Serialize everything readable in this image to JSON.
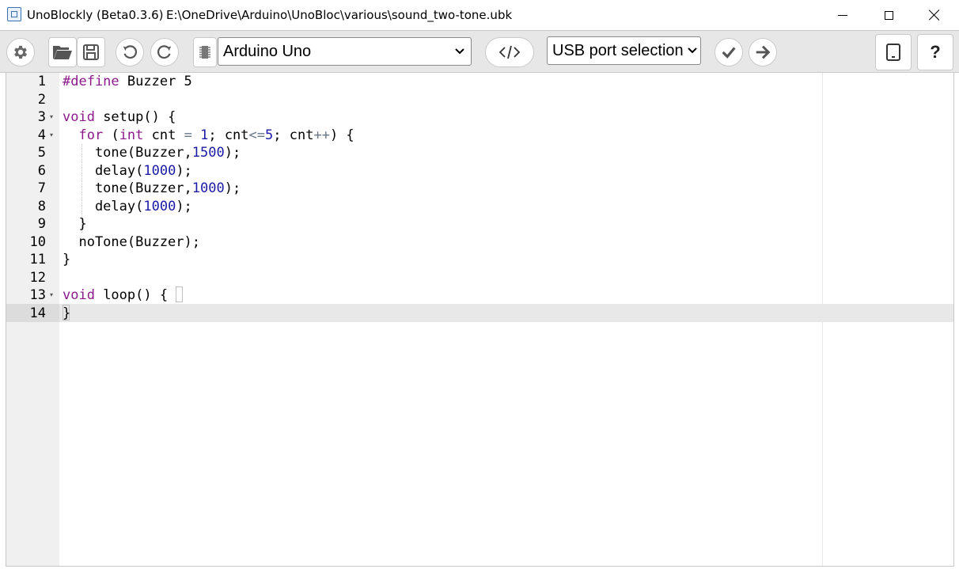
{
  "window": {
    "app_title": "UnoBlockly (Beta0.3.6)",
    "file_path": "E:\\OneDrive\\Arduino\\UnoBloc\\various\\sound_two-tone.ubk"
  },
  "toolbar": {
    "board_select": "Arduino Uno",
    "port_select": "USB port selection",
    "help_label": "?",
    "icons": [
      "gear-icon",
      "folder-open-icon",
      "save-icon",
      "undo-icon",
      "redo-icon",
      "chip-icon",
      "code-icon",
      "check-icon",
      "arrow-right-icon",
      "tablet-icon",
      "help-icon"
    ]
  },
  "editor": {
    "active_line": 14,
    "lines": [
      {
        "n": "1",
        "tokens": [
          {
            "t": "#define",
            "c": "kw"
          },
          {
            "t": " Buzzer 5",
            "c": ""
          }
        ]
      },
      {
        "n": "2",
        "tokens": []
      },
      {
        "n": "3",
        "fold": true,
        "tokens": [
          {
            "t": "void",
            "c": "kw"
          },
          {
            "t": " setup() {",
            "c": ""
          }
        ]
      },
      {
        "n": "4",
        "fold": true,
        "tokens": [
          {
            "t": "  ",
            "c": ""
          },
          {
            "t": "for",
            "c": "kw"
          },
          {
            "t": " (",
            "c": ""
          },
          {
            "t": "int",
            "c": "kw"
          },
          {
            "t": " cnt ",
            "c": ""
          },
          {
            "t": "=",
            "c": "op"
          },
          {
            "t": " ",
            "c": ""
          },
          {
            "t": "1",
            "c": "num"
          },
          {
            "t": "; cnt",
            "c": ""
          },
          {
            "t": "<=",
            "c": "op"
          },
          {
            "t": "5",
            "c": "num"
          },
          {
            "t": "; cnt",
            "c": ""
          },
          {
            "t": "++",
            "c": "op"
          },
          {
            "t": ") {",
            "c": ""
          }
        ]
      },
      {
        "n": "5",
        "tokens": [
          {
            "t": "    tone(Buzzer,",
            "c": ""
          },
          {
            "t": "1500",
            "c": "num"
          },
          {
            "t": ");",
            "c": ""
          }
        ]
      },
      {
        "n": "6",
        "tokens": [
          {
            "t": "    delay(",
            "c": ""
          },
          {
            "t": "1000",
            "c": "num"
          },
          {
            "t": ");",
            "c": ""
          }
        ]
      },
      {
        "n": "7",
        "tokens": [
          {
            "t": "    tone(Buzzer,",
            "c": ""
          },
          {
            "t": "1000",
            "c": "num"
          },
          {
            "t": ");",
            "c": ""
          }
        ]
      },
      {
        "n": "8",
        "tokens": [
          {
            "t": "    delay(",
            "c": ""
          },
          {
            "t": "1000",
            "c": "num"
          },
          {
            "t": ");",
            "c": ""
          }
        ]
      },
      {
        "n": "9",
        "tokens": [
          {
            "t": "  }",
            "c": ""
          }
        ]
      },
      {
        "n": "10",
        "tokens": [
          {
            "t": "  noTone(Buzzer);",
            "c": ""
          }
        ]
      },
      {
        "n": "11",
        "tokens": [
          {
            "t": "}",
            "c": ""
          }
        ]
      },
      {
        "n": "12",
        "tokens": []
      },
      {
        "n": "13",
        "fold": true,
        "tokens": [
          {
            "t": "void",
            "c": "kw"
          },
          {
            "t": " loop() {",
            "c": ""
          }
        ]
      },
      {
        "n": "14",
        "tokens": [
          {
            "t": "}",
            "c": ""
          }
        ]
      }
    ]
  }
}
